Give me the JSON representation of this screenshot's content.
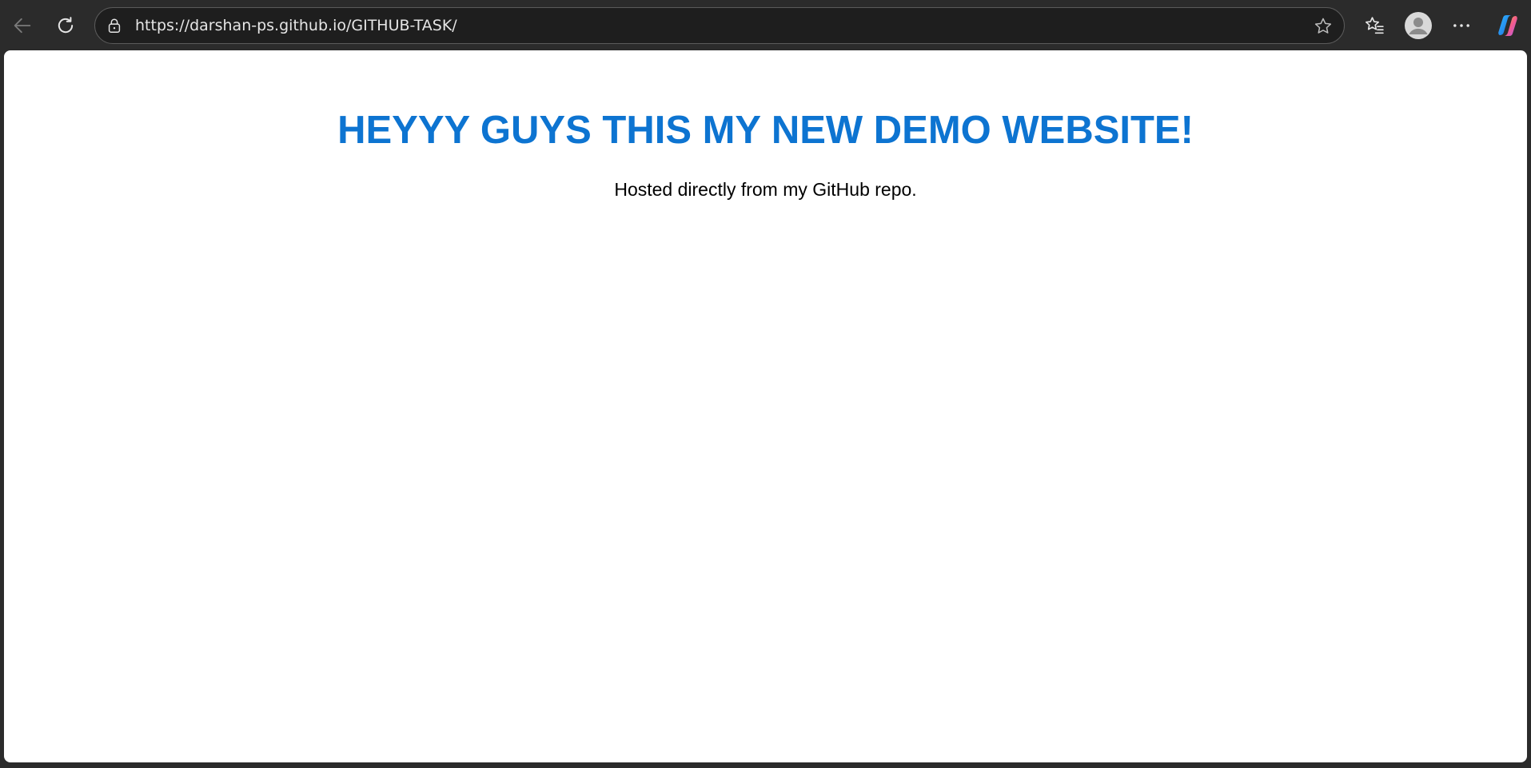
{
  "browser": {
    "url": "https://darshan-ps.github.io/GITHUB-TASK/",
    "icons": {
      "back": "back-arrow-icon",
      "refresh": "refresh-icon",
      "lock": "lock-icon",
      "favorite": "star-icon",
      "favorites_list": "favorites-icon",
      "profile": "profile-icon",
      "menu": "more-icon",
      "copilot": "copilot-icon"
    }
  },
  "page": {
    "heading": "HEYYY GUYS THIS MY NEW DEMO WEBSITE!",
    "subtitle": "Hosted directly from my GitHub repo.",
    "heading_color": "#0d74d1",
    "background_color": "#ffffff"
  }
}
